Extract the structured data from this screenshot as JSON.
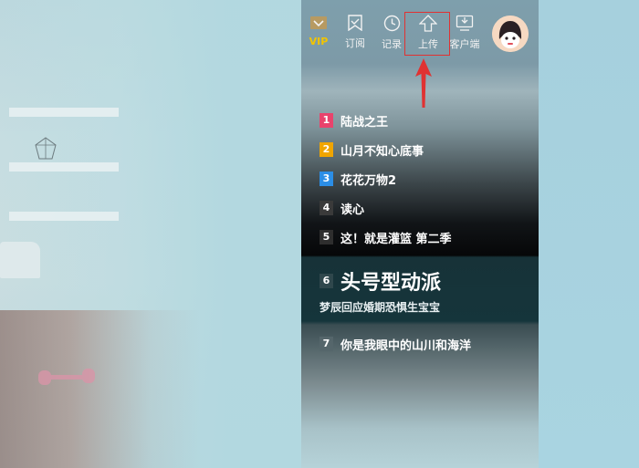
{
  "nav": {
    "vip_label": "VIP",
    "subscribe_label": "订阅",
    "history_label": "记录",
    "upload_label": "上传",
    "client_label": "客户端"
  },
  "colors": {
    "vip": "#f2c400",
    "rank1": "#e9436c",
    "rank2": "#f0a500",
    "rank3": "#2b8ee6",
    "rank_default": "#3a3a3a",
    "annotation": "#e03232"
  },
  "icons": [
    "vip-crown-icon",
    "subscribe-icon",
    "clock-icon",
    "upload-arrow-icon",
    "download-client-icon",
    "avatar-icon",
    "red-arrow-icon"
  ],
  "ranking": [
    {
      "num": "1",
      "title": "陆战之王"
    },
    {
      "num": "2",
      "title": "山月不知心底事"
    },
    {
      "num": "3",
      "title": "花花万物2"
    },
    {
      "num": "4",
      "title": "读心"
    },
    {
      "num": "5",
      "title": "这！就是灌篮 第二季"
    }
  ],
  "featured": {
    "num": "6",
    "title": "头号型动派",
    "subtitle": "梦辰回应婚期恐惧生宝宝"
  },
  "after": [
    {
      "num": "7",
      "title": "你是我眼中的山川和海洋"
    }
  ]
}
